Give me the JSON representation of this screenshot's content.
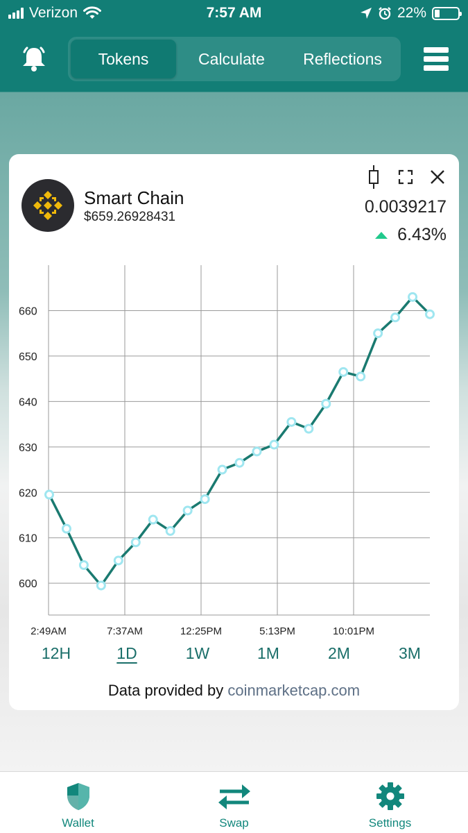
{
  "status_bar": {
    "carrier": "Verizon",
    "time": "7:57 AM",
    "battery": "22%",
    "battery_level": 0.22
  },
  "header": {
    "tabs": [
      {
        "label": "Tokens",
        "active": true
      },
      {
        "label": "Calculate",
        "active": false
      },
      {
        "label": "Reflections",
        "active": false
      }
    ],
    "icons": [
      "bell-icon",
      "menu-icon"
    ]
  },
  "token": {
    "name": "Smart Chain",
    "price": "$659.26928431",
    "value": "0.0039217",
    "change": "6.43%",
    "change_direction": "up"
  },
  "card_icons": [
    "candlestick-icon",
    "expand-icon",
    "close-icon"
  ],
  "chart_data": {
    "type": "line",
    "x_tick_labels": [
      "2:49AM",
      "7:37AM",
      "12:25PM",
      "5:13PM",
      "10:01PM"
    ],
    "y_ticks": [
      600,
      610,
      620,
      630,
      640,
      650,
      660
    ],
    "ylim": [
      593,
      670
    ],
    "grid": true,
    "line_color": "#1a7a70",
    "point_color": "#9fe6f0",
    "series": [
      {
        "values": [
          619.5,
          612,
          604,
          599.5,
          605,
          609,
          614,
          611.5,
          616,
          618.5,
          625,
          626.5,
          629,
          630.5,
          635.5,
          634,
          639.5,
          646.5,
          645.5,
          655,
          658.5,
          663,
          659.2
        ]
      }
    ]
  },
  "ranges": [
    {
      "label": "12H",
      "active": false
    },
    {
      "label": "1D",
      "active": true
    },
    {
      "label": "1W",
      "active": false
    },
    {
      "label": "1M",
      "active": false
    },
    {
      "label": "2M",
      "active": false
    },
    {
      "label": "3M",
      "active": false
    }
  ],
  "credit": {
    "prefix": "Data provided by",
    "link": "coinmarketcap.com"
  },
  "bottom_nav": [
    {
      "label": "Wallet",
      "icon": "shield-icon"
    },
    {
      "label": "Swap",
      "icon": "swap-arrows-icon"
    },
    {
      "label": "Settings",
      "icon": "gear-icon"
    }
  ],
  "colors": {
    "brand_teal": "#127e76",
    "accent_green": "#21c98c",
    "binance_yellow": "#f0b90b"
  }
}
